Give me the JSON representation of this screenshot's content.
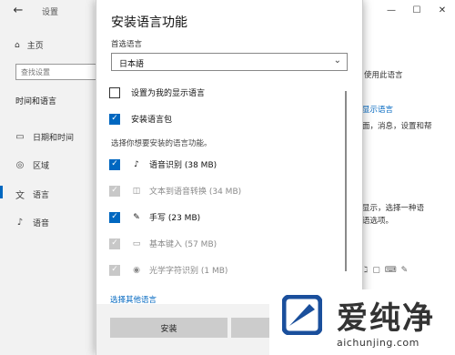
{
  "settings": {
    "app_title": "设置",
    "home_label": "主页",
    "search_placeholder": "查找设置",
    "section_title": "时间和语言",
    "nav": [
      {
        "label": "日期和时间",
        "icon": "calendar-icon"
      },
      {
        "label": "区域",
        "icon": "globe-icon"
      },
      {
        "label": "语言",
        "icon": "language-icon"
      },
      {
        "label": "语音",
        "icon": "microphone-icon"
      }
    ],
    "window_controls": [
      "—",
      "☐",
      "✕"
    ],
    "right_texts": [
      "使用此语言",
      "显示语言",
      "面，消息，设置和帮",
      "显示，选择一种语",
      "语选项。"
    ]
  },
  "dialog": {
    "title": "安装语言功能",
    "preferred_label": "首选语言",
    "selected_language": "日本語",
    "set_display_label": "设置为我的显示语言",
    "install_pack_label": "安装语言包",
    "choose_features_label": "选择你想要安装的语言功能。",
    "features": [
      {
        "label": "语音识别 (38 MB)",
        "state": "checked",
        "icon": "microphone-icon"
      },
      {
        "label": "文本到语音转换 (34 MB)",
        "state": "disabled",
        "icon": "speech-icon"
      },
      {
        "label": "手写 (23 MB)",
        "state": "checked",
        "icon": "pen-icon"
      },
      {
        "label": "基本键入 (57 MB)",
        "state": "disabled",
        "icon": "keyboard-icon"
      },
      {
        "label": "光学字符识别 (1 MB)",
        "state": "disabled",
        "icon": "ocr-icon"
      }
    ],
    "more_link": "选择其他语言",
    "install_button": "安装",
    "accent_color": "#0067c0"
  },
  "watermark": {
    "brand_cn": "爱纯净",
    "url": "aichunjing.com"
  }
}
